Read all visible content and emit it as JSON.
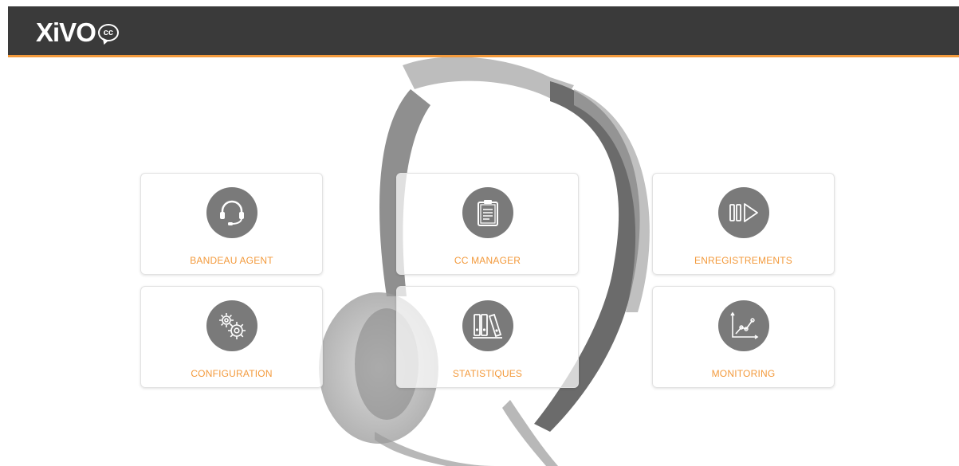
{
  "header": {
    "logo_text": "XiVO",
    "logo_badge": "cc"
  },
  "tiles": [
    {
      "label": "BANDEAU AGENT",
      "icon": "headset-icon"
    },
    {
      "label": "CC MANAGER",
      "icon": "clipboard-icon"
    },
    {
      "label": "ENREGISTREMENTS",
      "icon": "pause-play-icon"
    },
    {
      "label": "CONFIGURATION",
      "icon": "gears-icon"
    },
    {
      "label": "STATISTIQUES",
      "icon": "binders-icon"
    },
    {
      "label": "MONITORING",
      "icon": "line-chart-icon"
    }
  ],
  "colors": {
    "header_bg": "#3a3a3a",
    "accent": "#f39a3c",
    "icon_circle": "#7a7a7a"
  }
}
